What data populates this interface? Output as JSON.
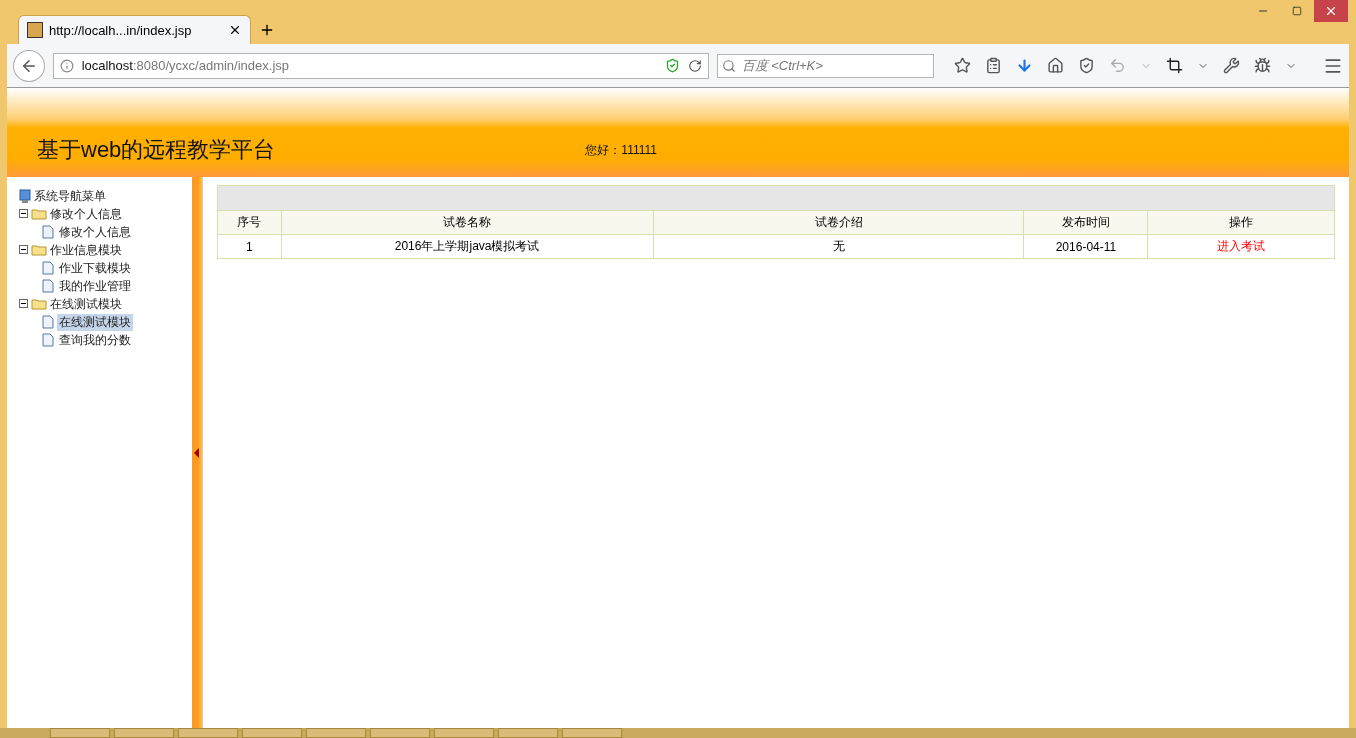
{
  "browser": {
    "tab_title": "http://localh...in/index.jsp",
    "url_host": "localhost",
    "url_rest": ":8080/ycxc/admin/index.jsp",
    "search_placeholder": "百度 <Ctrl+K>"
  },
  "header": {
    "title": "基于web的远程教学平台",
    "greeting": "您好：111111"
  },
  "sidebar": {
    "root": "系统导航菜单",
    "items": [
      {
        "label": "修改个人信息",
        "expanded": true,
        "children": [
          {
            "label": "修改个人信息",
            "selected": false
          }
        ]
      },
      {
        "label": "作业信息模块",
        "expanded": true,
        "children": [
          {
            "label": "作业下载模块",
            "selected": false
          },
          {
            "label": "我的作业管理",
            "selected": false
          }
        ]
      },
      {
        "label": "在线测试模块",
        "expanded": true,
        "children": [
          {
            "label": "在线测试模块",
            "selected": true
          },
          {
            "label": "查询我的分数",
            "selected": false
          }
        ]
      }
    ]
  },
  "table": {
    "columns": [
      "序号",
      "试卷名称",
      "试卷介绍",
      "发布时间",
      "操作"
    ],
    "rows": [
      {
        "cells": [
          "1",
          "2016年上学期java模拟考试",
          "无",
          "2016-04-11"
        ],
        "action": "进入考试"
      }
    ]
  }
}
